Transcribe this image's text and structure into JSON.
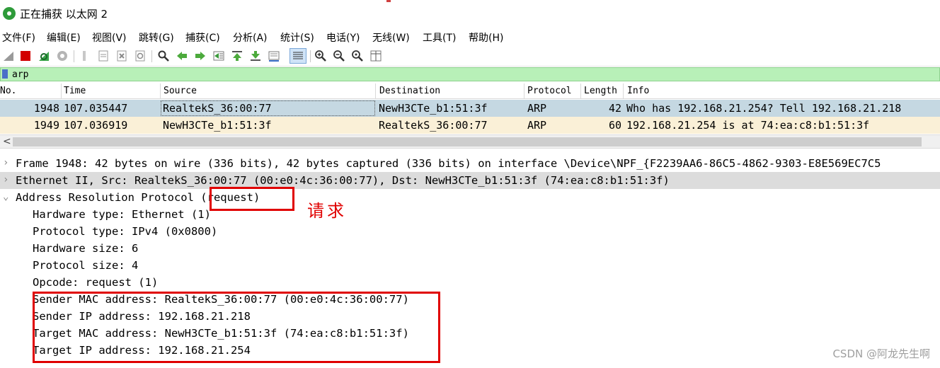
{
  "window": {
    "title": "正在捕获 以太网 2"
  },
  "menu": [
    "文件(F)",
    "编辑(E)",
    "视图(V)",
    "跳转(G)",
    "捕获(C)",
    "分析(A)",
    "统计(S)",
    "电话(Y)",
    "无线(W)",
    "工具(T)",
    "帮助(H)"
  ],
  "toolbar_icons": [
    "shark-fin-start-icon",
    "stop-icon",
    "restart-icon",
    "options-gear-icon",
    "open-file-icon",
    "save-file-icon",
    "close-file-icon",
    "reload-icon",
    "find-icon",
    "back-arrow-icon",
    "forward-arrow-icon",
    "go-to-packet-icon",
    "first-packet-icon",
    "last-packet-icon",
    "autoscroll-icon",
    "colorize-icon",
    "zoom-in-icon",
    "zoom-out-icon",
    "zoom-reset-icon",
    "resize-columns-icon"
  ],
  "filter": {
    "value": "arp"
  },
  "packet_list": {
    "headers": {
      "no": "No.",
      "time": "Time",
      "source": "Source",
      "destination": "Destination",
      "protocol": "Protocol",
      "length": "Length",
      "info": "Info"
    },
    "rows": [
      {
        "no": "1948",
        "time": "107.035447",
        "source": "RealtekS_36:00:77",
        "destination": "NewH3CTe_b1:51:3f",
        "protocol": "ARP",
        "length": "42",
        "info": "Who has 192.168.21.254? Tell 192.168.21.218"
      },
      {
        "no": "1949",
        "time": "107.036919",
        "source": "NewH3CTe_b1:51:3f",
        "destination": "RealtekS_36:00:77",
        "protocol": "ARP",
        "length": "60",
        "info": "192.168.21.254 is at 74:ea:c8:b1:51:3f"
      }
    ]
  },
  "scrollbar": {
    "left_arrow": "<"
  },
  "details": {
    "frame": "Frame 1948: 42 bytes on wire (336 bits), 42 bytes captured (336 bits) on interface \\Device\\NPF_{F2239AA6-86C5-4862-9303-E8E569EC7C5",
    "ethernet": "Ethernet II, Src: RealtekS_36:00:77 (00:e0:4c:36:00:77), Dst: NewH3CTe_b1:51:3f (74:ea:c8:b1:51:3f)",
    "arp": "Address Resolution Protocol (request)",
    "fields": [
      "Hardware type: Ethernet (1)",
      "Protocol type: IPv4 (0x0800)",
      "Hardware size: 6",
      "Protocol size: 4",
      "Opcode: request (1)",
      "Sender MAC address: RealtekS_36:00:77 (00:e0:4c:36:00:77)",
      "Sender IP address: 192.168.21.218",
      "Target MAC address: NewH3CTe_b1:51:3f (74:ea:c8:b1:51:3f)",
      "Target IP address: 192.168.21.254"
    ]
  },
  "annotation": {
    "text": "请求",
    "color": "#e00000"
  },
  "watermark": "CSDN @阿龙先生啊",
  "colors": {
    "filter_valid": "#b8f0b8",
    "row_selected": "#c5d8e2",
    "row_arp": "#faf0d7",
    "highlight_box": "#e00000"
  }
}
